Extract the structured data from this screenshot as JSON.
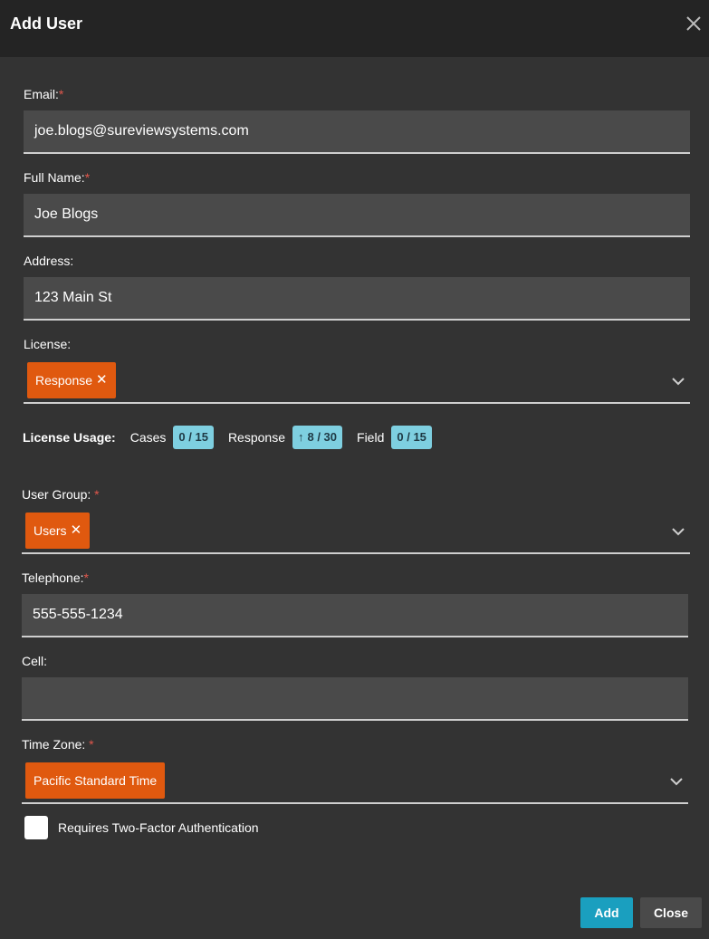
{
  "dialog": {
    "title": "Add User"
  },
  "fields": {
    "email": {
      "label": "Email:",
      "required": "*",
      "value": "joe.blogs@sureviewsystems.com"
    },
    "full_name": {
      "label": "Full Name:",
      "required": "*",
      "value": "Joe Blogs"
    },
    "address": {
      "label": "Address:",
      "value": "123 Main St"
    },
    "license": {
      "label": "License:",
      "chip": "Response",
      "chip_remove": "✕"
    },
    "user_group": {
      "label": "User Group: ",
      "required": "*",
      "chip": "Users",
      "chip_remove": "✕"
    },
    "telephone": {
      "label": "Telephone:",
      "required": "*",
      "value": "555-555-1234"
    },
    "cell": {
      "label": "Cell:",
      "value": ""
    },
    "time_zone": {
      "label": "Time Zone: ",
      "required": "*",
      "chip": "Pacific Standard Time"
    }
  },
  "license_usage": {
    "label": "License Usage:",
    "items": [
      {
        "name": "Cases",
        "value": "0 / 15",
        "arrow": ""
      },
      {
        "name": "Response",
        "value": "8 / 30",
        "arrow": "↑"
      },
      {
        "name": "Field",
        "value": "0 / 15",
        "arrow": ""
      }
    ]
  },
  "two_factor": {
    "label": "Requires Two-Factor Authentication",
    "checked": false
  },
  "buttons": {
    "add": "Add",
    "close": "Close"
  },
  "icons": {
    "close": "close-icon",
    "dropdown": "chevron-down-icon",
    "arrow_up": "arrow-up-icon"
  },
  "colors": {
    "accent": "#e0590f",
    "primary_button": "#1a9fbf",
    "badge": "#7ecfe0",
    "required": "#e2574c"
  }
}
